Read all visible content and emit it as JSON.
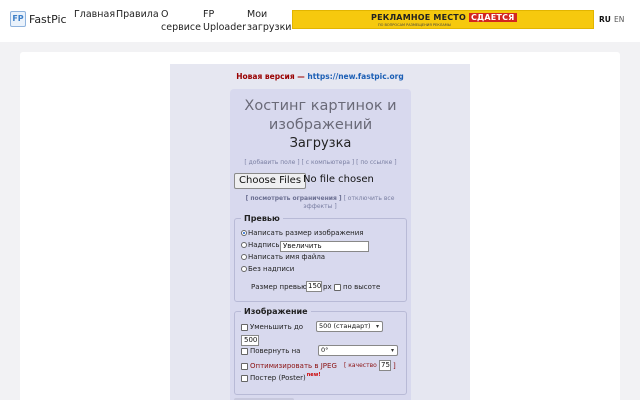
{
  "header": {
    "logo_mark": "FP",
    "logo_text": "FastPic",
    "nav": {
      "home": "Главная",
      "rules": "Правила",
      "about_line1": "О",
      "about_line2": "сервисе",
      "uploader_line1": "FP",
      "uploader_line2": "Uploader",
      "downloads_line1": "Мои",
      "downloads_line2": "загрузки"
    },
    "banner": {
      "text_main": "РЕКЛАМНОЕ МЕСТО",
      "text_highlight": "СДАЕТСЯ",
      "text_small": "ПО ВОПРОСАМ РАЗМЕЩЕНИЯ РЕКЛАМЫ"
    },
    "lang_ru": "RU",
    "lang_en": "EN"
  },
  "version": {
    "label": "Новая версия —",
    "url": "https://new.fastpic.org"
  },
  "upload": {
    "title": "Хостинг картинок и изображений",
    "subtitle": "Загрузка",
    "links": "[ добавить поле ] [ с компьютера ] [ по ссылке ]",
    "file_button": "Choose Files",
    "file_status": "No file chosen",
    "limits_bold": "[ посмотреть ограничения ]",
    "limits_rest": "[ отключить все эффекты ]"
  },
  "preview": {
    "legend": "Превью",
    "opt_size": "Написать размер изображения",
    "opt_caption": "Надпись",
    "caption_value": "Увеличить",
    "opt_filename": "Написать имя файла",
    "opt_none": "Без надписи",
    "size_label": "Размер превью",
    "size_value": "150",
    "size_unit": "px",
    "height_label": "по высоте"
  },
  "image": {
    "legend": "Изображение",
    "resize_label": "Уменьшить до",
    "resize_select": "500 (стандарт)",
    "resize_value": "500",
    "rotate_label": "Повернуть на",
    "rotate_select": "0°",
    "jpeg_label": "Оптимизировать в JPEG",
    "quality_label": "[ качество",
    "quality_value": "75",
    "quality_close": "]",
    "poster_label": "Постер (Poster)",
    "new_badge": "new!"
  },
  "colors": {
    "banner": "#f6c90e",
    "version_red": "#990000",
    "link_blue": "#1c5fb5",
    "panel": "#e6e7f1",
    "inner": "#d8d9ee"
  }
}
